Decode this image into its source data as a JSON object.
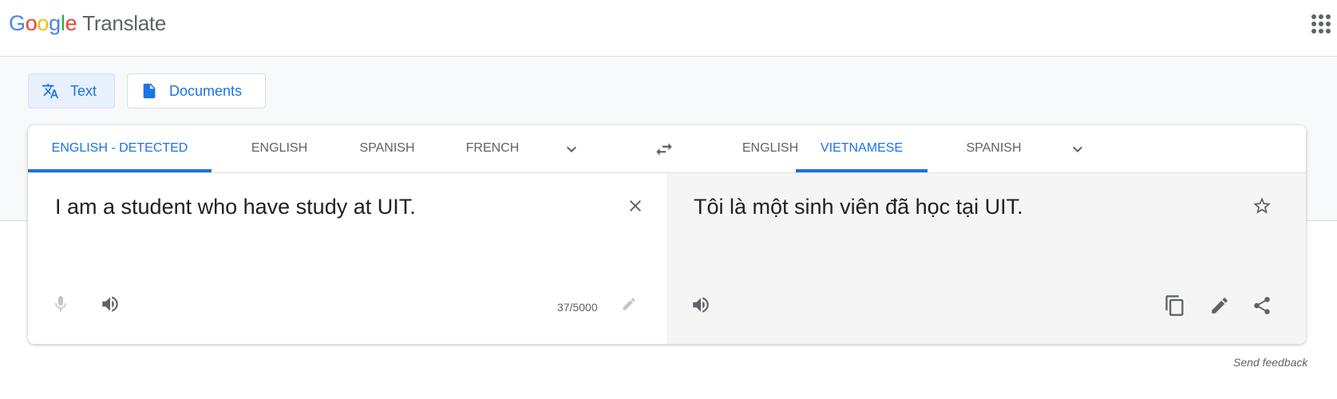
{
  "header": {
    "logo_letters": [
      "G",
      "o",
      "o",
      "g",
      "l",
      "e"
    ],
    "logo_colors": [
      "#4285F4",
      "#EA4335",
      "#FBBC05",
      "#4285F4",
      "#34A853",
      "#EA4335"
    ],
    "app_name": "Translate",
    "apps_icon": "apps-grid-icon"
  },
  "modes": [
    {
      "label": "Text",
      "icon": "translate-icon",
      "active": true
    },
    {
      "label": "Documents",
      "icon": "document-icon",
      "active": false
    }
  ],
  "source_tabs": [
    "ENGLISH - DETECTED",
    "ENGLISH",
    "SPANISH",
    "FRENCH"
  ],
  "target_tabs": [
    "ENGLISH",
    "VIETNAMESE",
    "SPANISH"
  ],
  "source": {
    "text": "I am a student who have study at UIT.",
    "char_count": "37/5000"
  },
  "target": {
    "text": "Tôi là một sinh viên đã học tại UIT."
  },
  "footer": {
    "feedback": "Send feedback"
  },
  "colors": {
    "accent": "#1a73e8",
    "text": "#202124",
    "muted": "#5f6368"
  }
}
